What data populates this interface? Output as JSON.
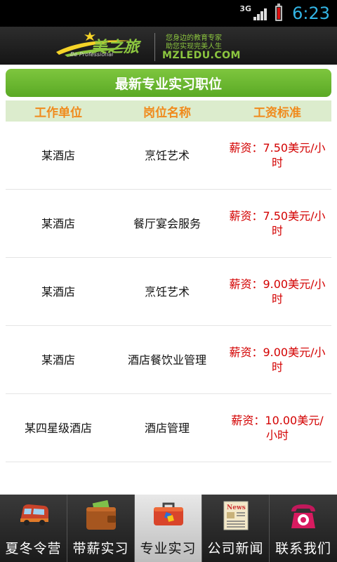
{
  "status_bar": {
    "network": "3G",
    "time": "6:23",
    "colors": {
      "clock": "#33b5e5",
      "battery": "#dd1111"
    }
  },
  "header": {
    "logo_text": "美之旅",
    "logo_subtext": "Be Professional",
    "slogan_line1": "您身边的教育专家",
    "slogan_line2": "助您实现完美人生",
    "domain": "MZLEDU.COM"
  },
  "page": {
    "title": "最新专业实习职位",
    "columns": [
      "工作单位",
      "岗位名称",
      "工资标准"
    ],
    "rows": [
      {
        "employer": "某酒店",
        "position": "烹饪艺术",
        "salary": "薪资：7.50美元/小时"
      },
      {
        "employer": "某酒店",
        "position": "餐厅宴会服务",
        "salary": "薪资：7.50美元/小时"
      },
      {
        "employer": "某酒店",
        "position": "烹饪艺术",
        "salary": "薪资：9.00美元/小时"
      },
      {
        "employer": "某酒店",
        "position": "酒店餐饮业管理",
        "salary": "薪资：9.00美元/小时"
      },
      {
        "employer": "某四星级酒店",
        "position": "酒店管理",
        "salary": "薪资：10.00美元/小时"
      }
    ]
  },
  "tabs": [
    {
      "label": "夏冬令营",
      "icon": "bus-icon",
      "active": false
    },
    {
      "label": "带薪实习",
      "icon": "wallet-icon",
      "active": false
    },
    {
      "label": "专业实习",
      "icon": "toolbox-icon",
      "active": true
    },
    {
      "label": "公司新闻",
      "icon": "newspaper-icon",
      "active": false
    },
    {
      "label": "联系我们",
      "icon": "telephone-icon",
      "active": false
    }
  ],
  "colors": {
    "accent_green": "#6ab82f",
    "header_orange": "#f08a1c",
    "salary_red": "#d30000",
    "column_header_bg": "#dceccd"
  }
}
